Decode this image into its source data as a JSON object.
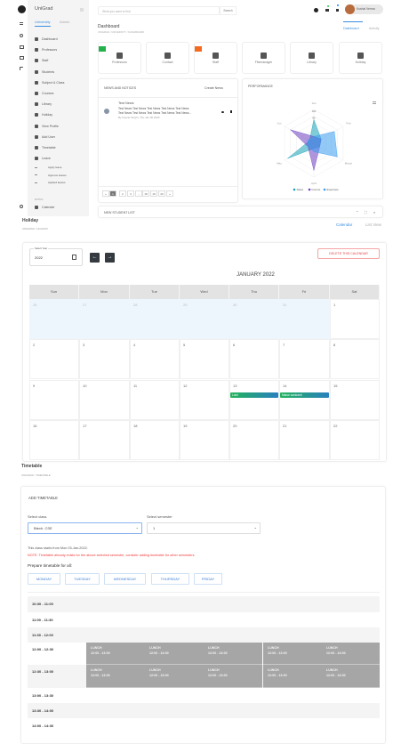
{
  "dashboard": {
    "brand": "UniGrad",
    "sidebar_tabs": [
      "University",
      "Admin"
    ],
    "sidebar_items": [
      "Dashboard",
      "Professors",
      "Staff",
      "Students",
      "Subject & Class",
      "Courses",
      "Library",
      "Holiday",
      "View Profile",
      "Add User",
      "Timetable",
      "Leave"
    ],
    "leave_sub": [
      "Apply leave",
      "Approve leaves",
      "Applied leaves"
    ],
    "extra_label": "EXTRA",
    "calendar_item": "Calender",
    "search_placeholder": "What you want to find",
    "search_button": "Search",
    "user_name": "Kushal Verma",
    "title": "Dashboard",
    "breadcrumb": "UNIGRAD / UNIVERSITY / DASHBOARD",
    "tabs": [
      "Dashboard",
      "Activity"
    ],
    "tiles": [
      "Professors",
      "Contact",
      "Staff",
      "Filemanager",
      "Library",
      "Holiday"
    ],
    "news": {
      "title": "NEWS AND NOTICES",
      "create": "Create News",
      "item_title": "Test News",
      "item_text1": "Test News Test News Test News Test News Test News",
      "item_text2": "Test News Test News Test News Test News Test News...",
      "item_meta": "By Keerat Singh | Thu Jan 06 2022",
      "pages": [
        "«",
        "1",
        "2",
        "3",
        "...",
        "18",
        "19",
        "20",
        "»"
      ]
    },
    "performance_title": "PERFORMANCE",
    "new_student_list": "NEW STUDENT LIST"
  },
  "chart_data": {
    "type": "radar",
    "title": "PERFORMANCE",
    "categories": [
      "Jan",
      "Feb",
      "March",
      "April",
      "May",
      "Jun"
    ],
    "ticks": [
      "100",
      "80"
    ],
    "rmax": 100,
    "series": [
      {
        "name": "Sales",
        "color": "#17a2b8",
        "values": [
          70,
          25,
          20,
          15,
          90,
          15
        ]
      },
      {
        "name": "Income",
        "color": "#6f42c1",
        "values": [
          20,
          25,
          20,
          80,
          20,
          80
        ]
      },
      {
        "name": "Expenses",
        "color": "#3b9cf0",
        "values": [
          20,
          70,
          80,
          25,
          20,
          20
        ]
      }
    ]
  },
  "holiday": {
    "title": "Holiday",
    "breadcrumb": "UNIGRAD / HOLIDAY",
    "views": [
      "Calendar",
      "List View"
    ],
    "year_label": "Select Year",
    "year": "2022",
    "delete": "DELETE THIS CALENDAR",
    "month": "JANUARY 2022",
    "weekdays": [
      "Sun",
      "Mon",
      "Tue",
      "Wed",
      "Thu",
      "Fri",
      "Sat"
    ],
    "weeks": [
      [
        "26",
        "27",
        "28",
        "29",
        "30",
        "31",
        "1"
      ],
      [
        "2",
        "3",
        "4",
        "5",
        "6",
        "7",
        "8"
      ],
      [
        "9",
        "10",
        "11",
        "12",
        "13",
        "14",
        "15"
      ],
      [
        "16",
        "17",
        "18",
        "19",
        "20",
        "21",
        "22"
      ]
    ],
    "events": [
      {
        "label": "Lohri",
        "week": 2,
        "day": 4
      },
      {
        "label": "Makar sankranti",
        "week": 2,
        "day": 5
      }
    ]
  },
  "timetable": {
    "title": "Timetable",
    "breadcrumb": "UNIGRAD / TIMETABLE",
    "card_title": "ADD TIMETABLE",
    "class_label": "Select class",
    "class_value": "Btech. CSE",
    "sem_label": "Select semester",
    "sem_value": "1",
    "info": "This class starts from Mon 03-Jan-2022.",
    "note": "NOTE: Timetable already exists for the above selected semester, consider adding timetable for other semesters.",
    "prepare": "Prepare timetable for all:",
    "days": [
      "MONDAY",
      "TUESDAY",
      "WEDNESDAY",
      "THURSDAY",
      "FRIDAY"
    ],
    "slots": [
      "10:30 - 11:00",
      "11:00 - 11:30",
      "11:30 - 12:00",
      "12:00 - 12:30",
      "12:30 - 13:00",
      "13:00 - 13:30",
      "13:30 - 14:00",
      "14:00 - 14:30"
    ],
    "lunch_label": "LUNCH",
    "lunch_time": "12:00 - 13:00"
  }
}
